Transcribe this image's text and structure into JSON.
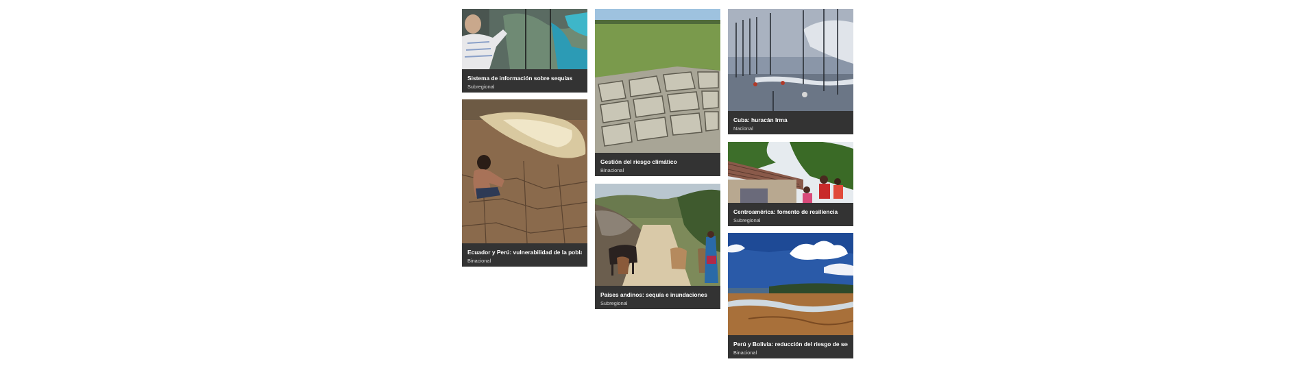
{
  "projects": [
    {
      "title": "Sistema de información sobre sequías",
      "scope": "Subregional",
      "image": "researcher-pointing-at-climate-map-screen"
    },
    {
      "title": "Gestión del riesgo climático",
      "scope": "Binacional",
      "image": "cracked-dry-earth-under-grass"
    },
    {
      "title": "Cuba: huracán Irma",
      "scope": "Nacional",
      "image": "flooded-seafront-with-streetlights"
    },
    {
      "title": "Ecuador y Perú: vulnerabilidad de la población",
      "scope": "Binacional",
      "image": "child-sitting-on-cracked-ground"
    },
    {
      "title": "Centroamérica: fomento de resiliencia",
      "scope": "Subregional",
      "image": "family-near-tiled-roof-house"
    },
    {
      "title": "Países andinos: sequía e inundaciones",
      "scope": "Subregional",
      "image": "cattle-on-mountain-road"
    },
    {
      "title": "Perú y Bolivia: reducción del riesgo de sequías",
      "scope": "Binacional",
      "image": "dried-lakebed-under-blue-sky"
    }
  ],
  "colors": {
    "card_background": "#333333",
    "title_text": "#ffffff",
    "scope_text": "#d8d8d8",
    "page_background": "#ffffff"
  }
}
